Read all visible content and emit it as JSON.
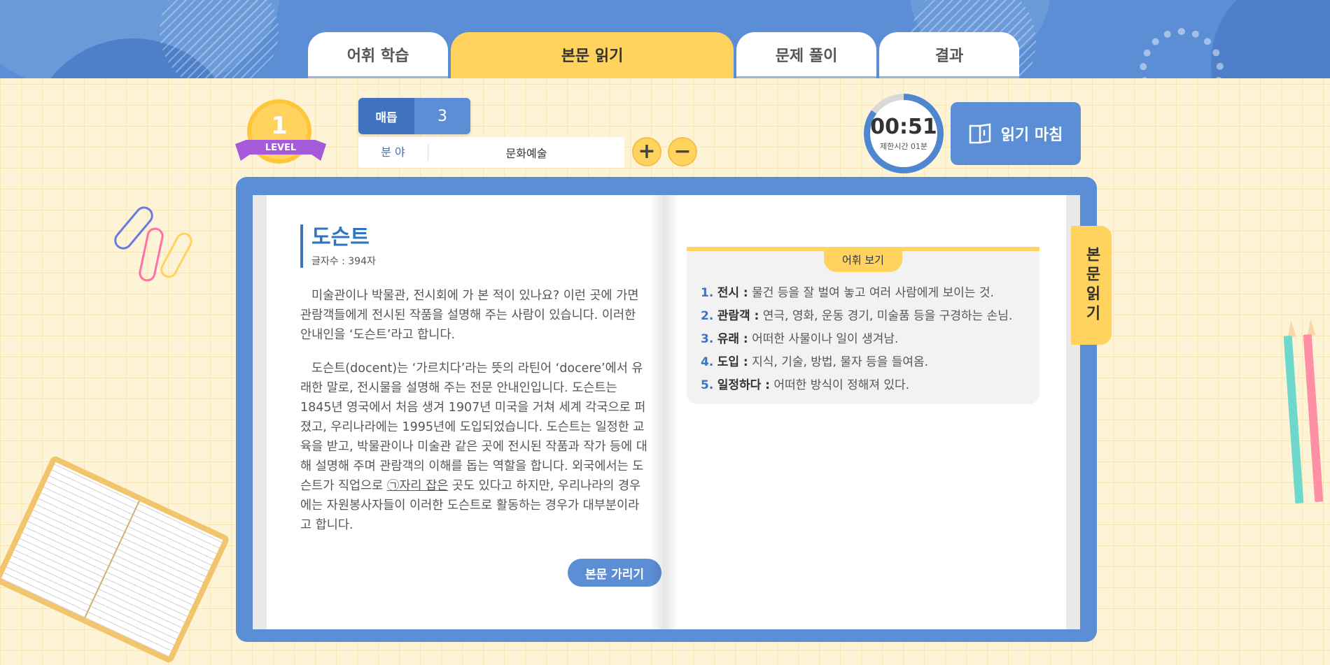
{
  "tabs": [
    {
      "label": "어휘 학습",
      "active": false
    },
    {
      "label": "본문 읽기",
      "active": true
    },
    {
      "label": "문제 풀이",
      "active": false
    },
    {
      "label": "결과",
      "active": false
    }
  ],
  "level": {
    "number": "1",
    "label": "LEVEL"
  },
  "topic": {
    "label": "매듭",
    "value": "3"
  },
  "field": {
    "label": "분 야",
    "value": "문화예술"
  },
  "controls": {
    "plus": "+",
    "minus": "−"
  },
  "timer": {
    "time": "00:51",
    "limit": "제한시간 01분",
    "progress": 0.85
  },
  "finish_button": "읽기 마침",
  "passage": {
    "title": "도슨트",
    "char_count": "글자수 : 394자",
    "p1": "미술관이나 박물관, 전시회에 가 본 적이 있나요? 이런 곳에 가면 관람객들에게 전시된 작품을 설명해 주는 사람이 있습니다. 이러한 안내인을 ‘도슨트’라고 합니다.",
    "p2_a": "도슨트(docent)는 ‘가르치다’라는 뜻의 라틴어 ‘docere’에서 유래한 말로, 전시물을 설명해 주는 전문 안내인입니다. 도슨트는 1845년 영국에서 처음 생겨 1907년 미국을 거쳐 세계 각국으로 퍼졌고, 우리나라에는 1995년에 도입되었습니다. 도슨트는 일정한 교육을 받고, 박물관이나 미술관 같은 곳에 전시된 작품과 작가 등에 대해 설명해 주며 관람객의 이해를 돕는 역할을 합니다. 외국에서는 도슨트가 직업으로 ",
    "p2_marker": "㉠자리 잡은",
    "p2_b": " 곳도 있다고 하지만, 우리나라의 경우에는 자원봉사자들이 이러한 도슨트로 활동하는 경우가 대부분이라고 합니다.",
    "hide_button": "본문 가리기"
  },
  "vocab": {
    "tab_label": "어휘 보기",
    "items": [
      {
        "num": "1.",
        "term": "전시 :",
        "def": " 물건 등을 잘 벌여 놓고 여러 사람에게 보이는 것."
      },
      {
        "num": "2.",
        "term": "관람객 :",
        "def": " 연극, 영화, 운동 경기, 미술품 등을 구경하는 손님."
      },
      {
        "num": "3.",
        "term": "유래 :",
        "def": " 어떠한 사물이나 일이 생겨남."
      },
      {
        "num": "4.",
        "term": "도입 :",
        "def": " 지식, 기술, 방법, 물자 등을 들여옴."
      },
      {
        "num": "5.",
        "term": "일정하다 :",
        "def": " 어떠한 방식이 정해져 있다."
      }
    ]
  },
  "side_tab": "본문읽기",
  "icons": [
    "book-open-icon",
    "plus-icon",
    "minus-icon",
    "level-medal-icon"
  ],
  "colors": {
    "primary": "#5b8ed4",
    "accent": "#ffd35e",
    "dark_blue": "#3f72bf",
    "purple": "#a55bd9"
  }
}
